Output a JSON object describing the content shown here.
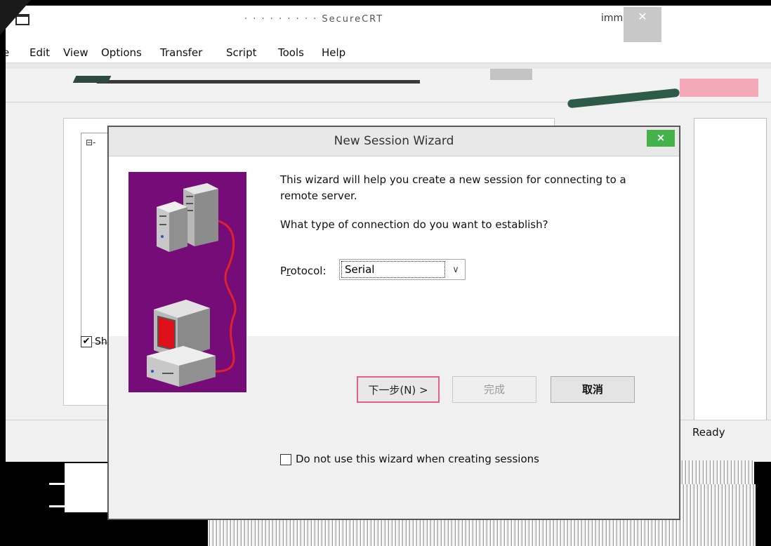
{
  "app": {
    "title": "· · · · · · · · ·  SecureCRT",
    "min_glyph": "ⅰⅿⅿⅰ",
    "close_glyph": "✕"
  },
  "menu": {
    "items": [
      "e",
      "Edit",
      "View",
      "Options",
      "Transfer",
      "Script",
      "Tools",
      "Help"
    ]
  },
  "session_manager": {
    "tree_expander": "⊟-",
    "show_label": "Sho",
    "show_checked": "✔"
  },
  "status_bar": {
    "ready": "Ready"
  },
  "wizard": {
    "title": "New Session Wizard",
    "close_glyph": "×",
    "intro": "This wizard will help you create a new session for connecting to a remote server.",
    "question": "What type of connection do you want to establish?",
    "protocol_label_prefix": "P",
    "protocol_label_mnemonic": "r",
    "protocol_label_suffix": "otocol:",
    "protocol_value": "Serial",
    "protocol_arrow": "∨",
    "no_wizard_label": "Do not use this wizard when creating sessions",
    "buttons": {
      "next": "下一步(N) >",
      "finish": "完成",
      "cancel": "取消"
    }
  }
}
